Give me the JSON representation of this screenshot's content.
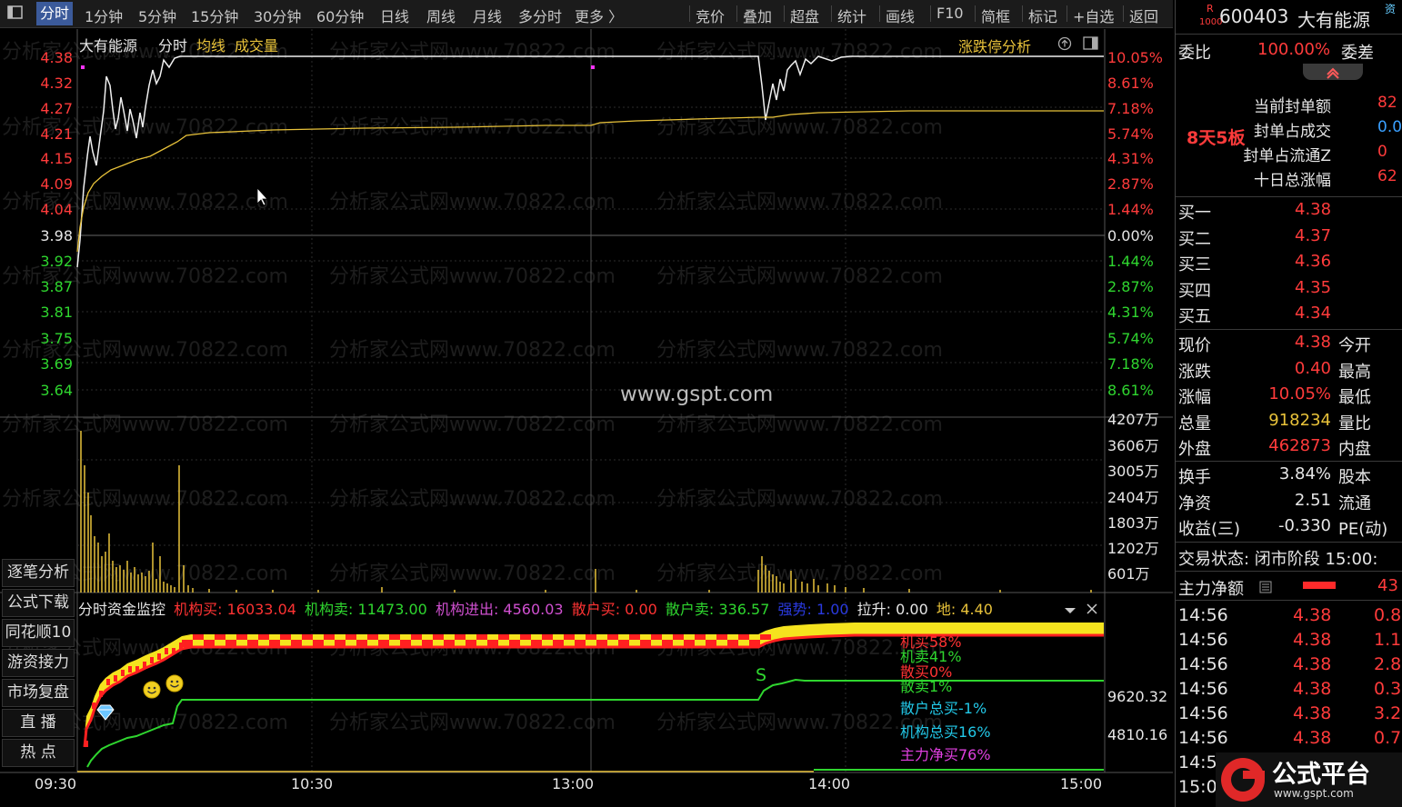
{
  "toolbar": {
    "tabs": [
      "分时",
      "1分钟",
      "5分钟",
      "15分钟",
      "30分钟",
      "60分钟",
      "日线",
      "周线",
      "月线",
      "多分时",
      "更多 〉"
    ],
    "tools": [
      "竞价",
      "叠加",
      "超盘",
      "统计",
      "画线",
      "F10",
      "简框",
      "标记",
      "+自选",
      "返回"
    ]
  },
  "chart": {
    "stock_name": "大有能源",
    "mode": "分时",
    "legend_avg": "均线",
    "legend_vol": "成交量",
    "limit_analysis": "涨跌停分析",
    "price_ticks": [
      "4.38",
      "4.32",
      "4.27",
      "4.21",
      "4.15",
      "4.09",
      "4.04",
      "3.98",
      "3.92",
      "3.87",
      "3.81",
      "3.75",
      "3.69",
      "3.64"
    ],
    "pct_ticks": [
      "10.05%",
      "8.61%",
      "7.18%",
      "5.74%",
      "4.31%",
      "2.87%",
      "1.44%",
      "0.00%",
      "1.44%",
      "2.87%",
      "4.31%",
      "5.74%",
      "7.18%",
      "8.61%"
    ],
    "vol_ticks": [
      "4207万",
      "3606万",
      "3005万",
      "2404万",
      "1803万",
      "1202万",
      "601万"
    ],
    "watermark": "www.gspt.com",
    "bg_watermark": "分析家公式网www.70822.com",
    "time_ticks": [
      "09:30",
      "10:30",
      "13:00",
      "14:00",
      "15:00"
    ]
  },
  "fund_monitor": {
    "title": "分时资金监控",
    "inst_buy": "机构买: 16033.04",
    "inst_sell": "机构卖: 11473.00",
    "inst_net": "机构进出: 4560.03",
    "retail_buy": "散户买: 0.00",
    "retail_sell": "散户卖: 336.57",
    "strength": "强势: 1.00",
    "lift": "拉升: 0.00",
    "ground": "地: 4.40",
    "right_ticks": [
      "9620.32",
      "4810.16"
    ],
    "labels": [
      {
        "text": "机买58%",
        "color": "#ff3333"
      },
      {
        "text": "机卖41%",
        "color": "#2fd62f"
      },
      {
        "text": "散买0%",
        "color": "#ff3333"
      },
      {
        "text": "散卖1%",
        "color": "#2fd62f"
      },
      {
        "text": "散户总买-1%",
        "color": "#22c8e8"
      },
      {
        "text": "机构总买16%",
        "color": "#22c8e8"
      },
      {
        "text": "主力净买76%",
        "color": "#e040e0"
      }
    ],
    "s_marker": "S"
  },
  "side_buttons": [
    "逐笔分析",
    "公式下载",
    "同花顺10",
    "游资接力",
    "市场复盘",
    "直  播",
    "热  点"
  ],
  "right_panel": {
    "code": "600403",
    "name": "大有能源",
    "badge_top": "R",
    "badge_bottom": "1000",
    "corner": "资",
    "weibi_label": "委比",
    "weibi_value": "100.00%",
    "weicha_label": "委差",
    "board": "8天5板",
    "seal_info": [
      {
        "label": "当前封单额",
        "value": "82"
      },
      {
        "label": "封单占成交",
        "value": "0.0"
      },
      {
        "label": "封单占流通Z",
        "value": "0"
      },
      {
        "label": "十日总涨幅",
        "value": "62"
      }
    ],
    "bids": [
      {
        "label": "买一",
        "price": "4.38"
      },
      {
        "label": "买二",
        "price": "4.37"
      },
      {
        "label": "买三",
        "price": "4.36"
      },
      {
        "label": "买四",
        "price": "4.35"
      },
      {
        "label": "买五",
        "price": "4.34"
      }
    ],
    "quote": [
      {
        "label": "现价",
        "value": "4.38",
        "label2": "今开",
        "color": "#ff3b3b"
      },
      {
        "label": "涨跌",
        "value": "0.40",
        "label2": "最高",
        "color": "#ff3b3b"
      },
      {
        "label": "涨幅",
        "value": "10.05%",
        "label2": "最低",
        "color": "#ff3b3b"
      },
      {
        "label": "总量",
        "value": "918234",
        "label2": "量比",
        "color": "#e8c23a"
      },
      {
        "label": "外盘",
        "value": "462873",
        "label2": "内盘",
        "color": "#ff3b3b"
      }
    ],
    "stats": [
      {
        "label": "换手",
        "value": "3.84%",
        "label2": "股本"
      },
      {
        "label": "净资",
        "value": "2.51",
        "label2": "流通"
      },
      {
        "label": "收益(三)",
        "value": "-0.330",
        "label2": "PE(动)"
      }
    ],
    "trade_status": "交易状态: 闭市阶段 15:00:",
    "main_net_label": "主力净额",
    "main_net_value": "43",
    "ticks": [
      {
        "time": "14:56",
        "price": "4.38",
        "vol": "0.8"
      },
      {
        "time": "14:56",
        "price": "4.38",
        "vol": "1.1"
      },
      {
        "time": "14:56",
        "price": "4.38",
        "vol": "2.8"
      },
      {
        "time": "14:56",
        "price": "4.38",
        "vol": "0.3"
      },
      {
        "time": "14:56",
        "price": "4.38",
        "vol": "3.2"
      },
      {
        "time": "14:56",
        "price": "4.38",
        "vol": "0.7"
      },
      {
        "time": "14:5",
        "price": "",
        "vol": ""
      },
      {
        "time": "15:0",
        "price": "",
        "vol": ""
      }
    ],
    "logo_text": "公式平台",
    "logo_url": "www.gspt.com"
  }
}
